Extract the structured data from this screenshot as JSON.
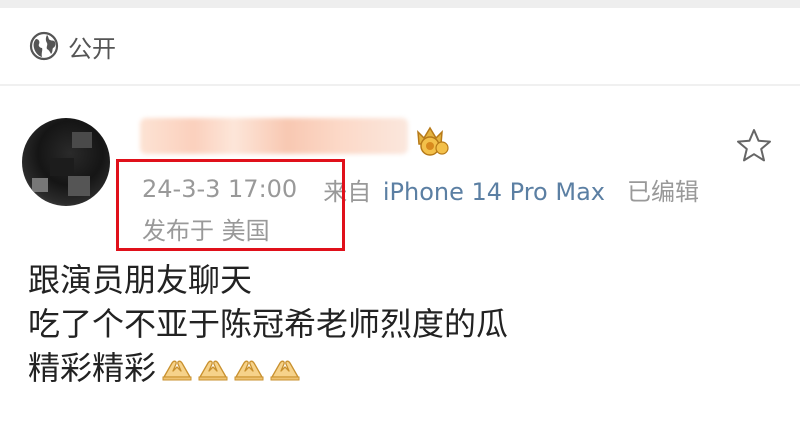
{
  "privacy": {
    "icon": "globe-icon",
    "label": "公开"
  },
  "post": {
    "author": {
      "avatar": "avatar-blurred",
      "name_blurred": true,
      "badge_icon": "crown-badge-icon"
    },
    "meta": {
      "time": "24-3-3 17:00",
      "source_prefix": "来自",
      "device": "iPhone 14 Pro Max",
      "edited": "已编辑",
      "location": "发布于 美国"
    },
    "favorite_icon": "star-icon",
    "text_lines": [
      "跟演员朋友聊天",
      "吃了个不亚于陈冠希老师烈度的瓜",
      "精彩精彩"
    ],
    "emoji_icon": "praying-hands-icon",
    "emoji_count": 4,
    "highlight_color": "#e0101a",
    "device_color": "#5b7fa3"
  }
}
